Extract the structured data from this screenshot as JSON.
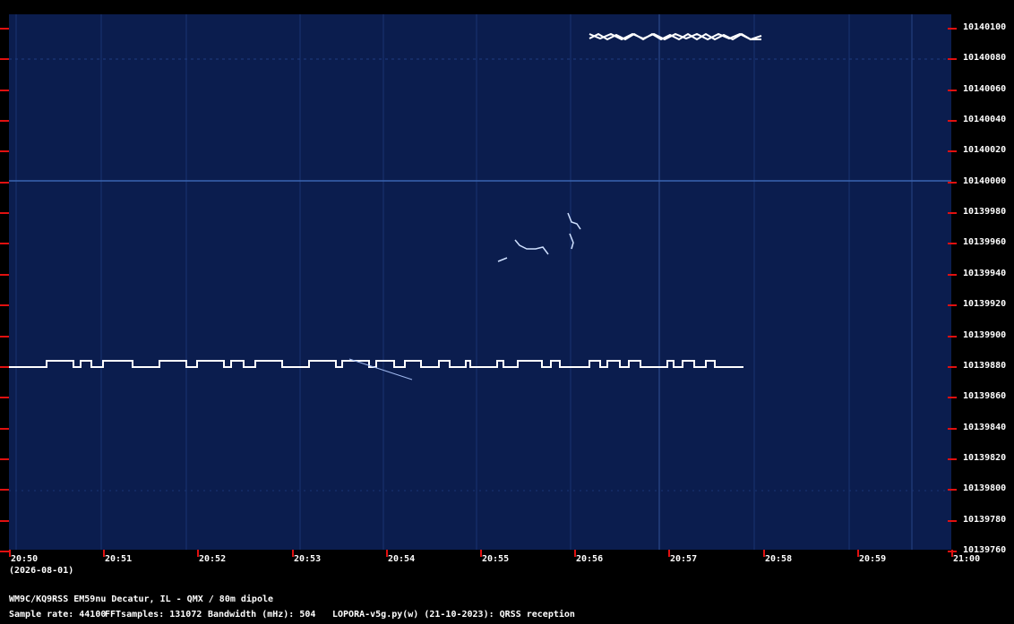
{
  "y_labels": [
    "10140100",
    "10140080",
    "10140060",
    "10140040",
    "10140020",
    "10140000",
    "10139980",
    "10139960",
    "10139940",
    "10139920",
    "10139900",
    "10139880",
    "10139860",
    "10139840",
    "10139820",
    "10139800",
    "10139780",
    "10139760"
  ],
  "x_labels": [
    "20:50",
    "20:51",
    "20:52",
    "20:53",
    "20:54",
    "20:55",
    "20:56",
    "20:57",
    "20:58",
    "20:59",
    "21:00"
  ],
  "date_label": "(2026-08-01)",
  "station_line": "WM9C/KQ9RSS EM59nu Decatur, IL - QMX / 80m dipole",
  "sample_rate": "Sample rate: 44100",
  "fft_samples": "FFTsamples: 131072",
  "bandwidth": "Bandwidth (mHz): 504",
  "software": "LOPORA-v5g.py(w) (21-10-2023): QRSS reception",
  "colors": {
    "background": "#000000",
    "waterfall": "#0b1d4e",
    "signal": "#ffffff",
    "tick": "#e01010"
  }
}
